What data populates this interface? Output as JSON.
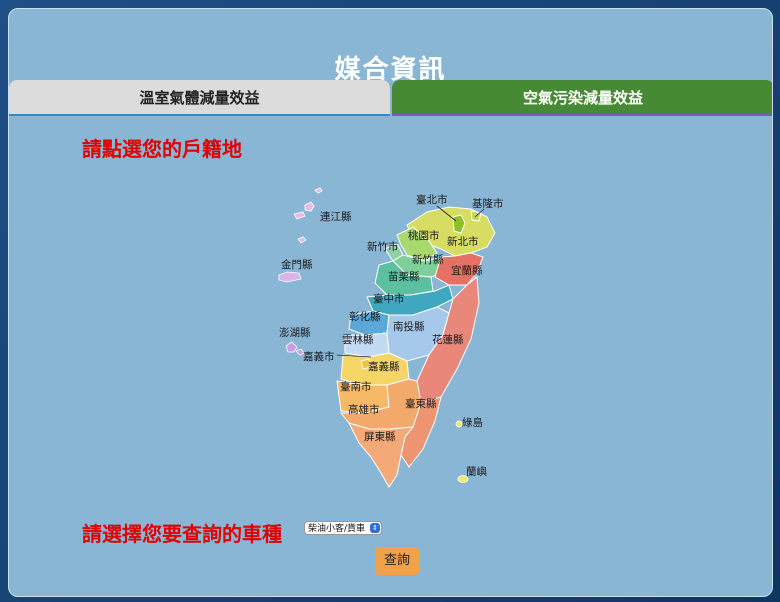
{
  "page_title": "媒合資訊",
  "tabs": [
    {
      "label": "溫室氣體減量效益",
      "active": false
    },
    {
      "label": "空氣污染減量效益",
      "active": true
    }
  ],
  "prompt_region": "請點選您的戶籍地",
  "prompt_vehicle": "請選擇您要查詢的車種",
  "vehicle_select": {
    "selected": "柴油小客/貨車"
  },
  "query_button": "查詢",
  "map_labels": {
    "lienchiang": "連江縣",
    "kinmen": "金門縣",
    "penghu": "澎湖縣",
    "taipei": "臺北市",
    "keelung": "基隆市",
    "taoyuan": "桃園市",
    "new_taipei": "新北市",
    "hsinchu_city": "新竹市",
    "hsinchu_county": "新竹縣",
    "miaoli": "苗栗縣",
    "yilan": "宜蘭縣",
    "taichung": "臺中市",
    "changhua": "彰化縣",
    "nantou": "南投縣",
    "yunlin": "雲林縣",
    "hualien": "花蓮縣",
    "chiayi_city": "嘉義市",
    "chiayi_county": "嘉義縣",
    "tainan": "臺南市",
    "kaohsiung": "高雄市",
    "taitung": "臺東縣",
    "pingtung": "屏東縣",
    "green_island": "綠島",
    "orchid_island": "蘭嶼"
  },
  "colors": {
    "accent_green": "#468a35",
    "prompt_red": "#e00000",
    "button_orange": "#f0a24b"
  }
}
